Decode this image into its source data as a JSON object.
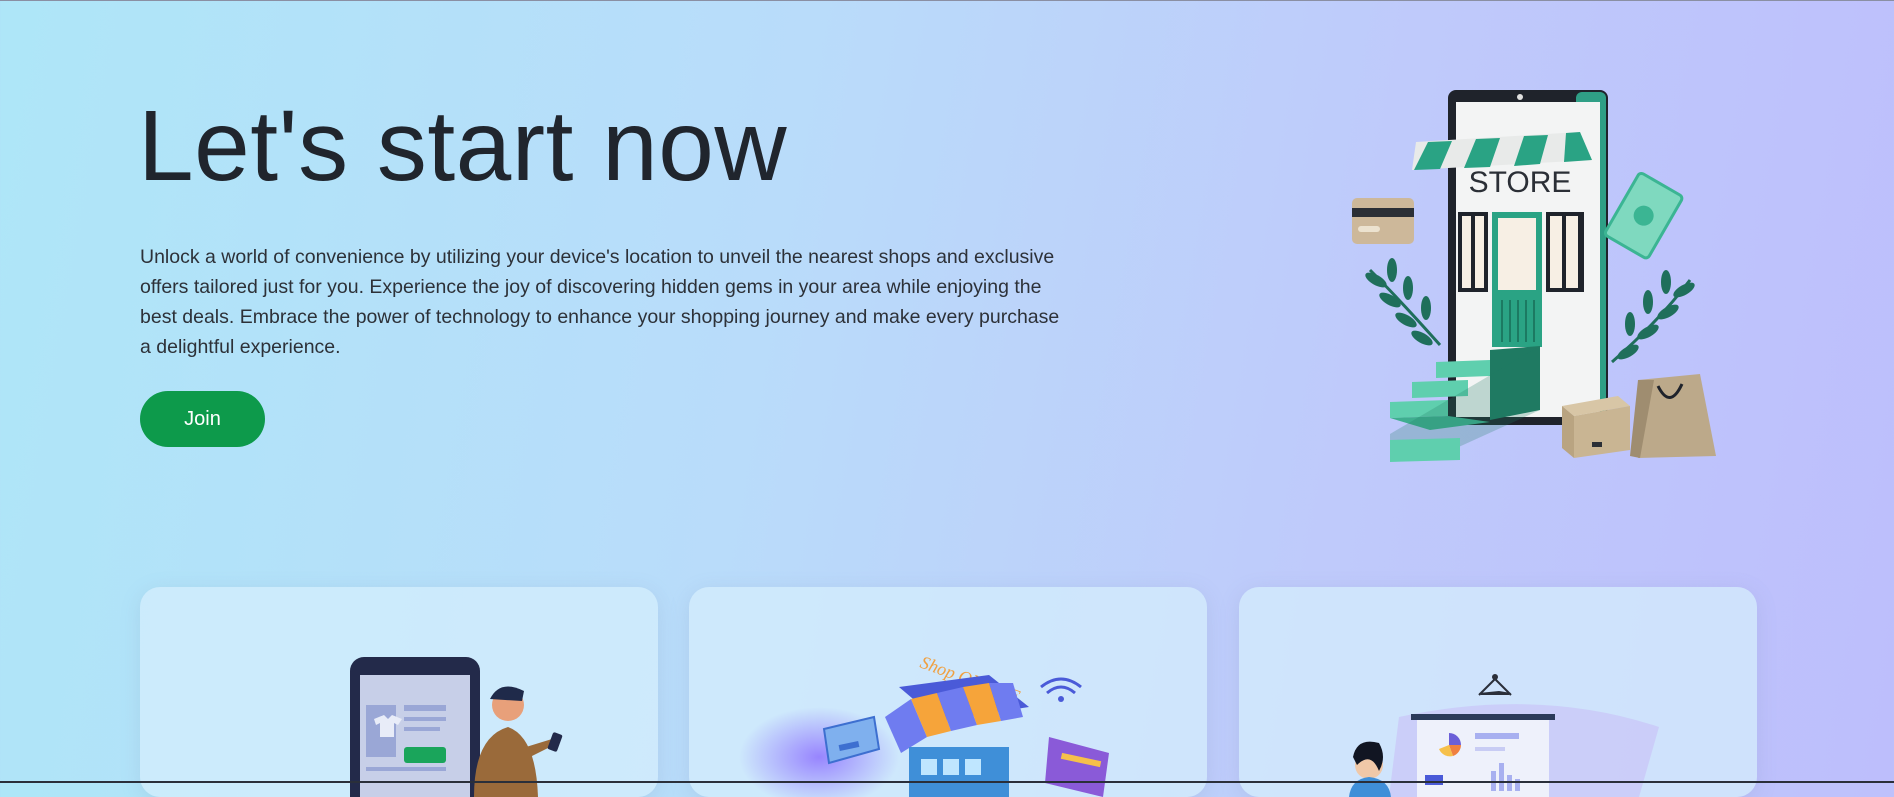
{
  "hero": {
    "title": "Let's start now",
    "description": "Unlock a world of convenience by utilizing your device's location to unveil the nearest shops and exclusive offers tailored just for you. Experience the joy of discovering hidden gems in your area while enjoying the best deals. Embrace the power of technology to enhance your shopping journey and make every purchase a delightful experience.",
    "join_label": "Join"
  },
  "illustration": {
    "store_sign": "STORE",
    "shop_online_sign": "Shop ONLINE"
  },
  "colors": {
    "accent_green": "#0d9a4b",
    "teal": "#3fbf9a",
    "title_text": "#20252d"
  }
}
